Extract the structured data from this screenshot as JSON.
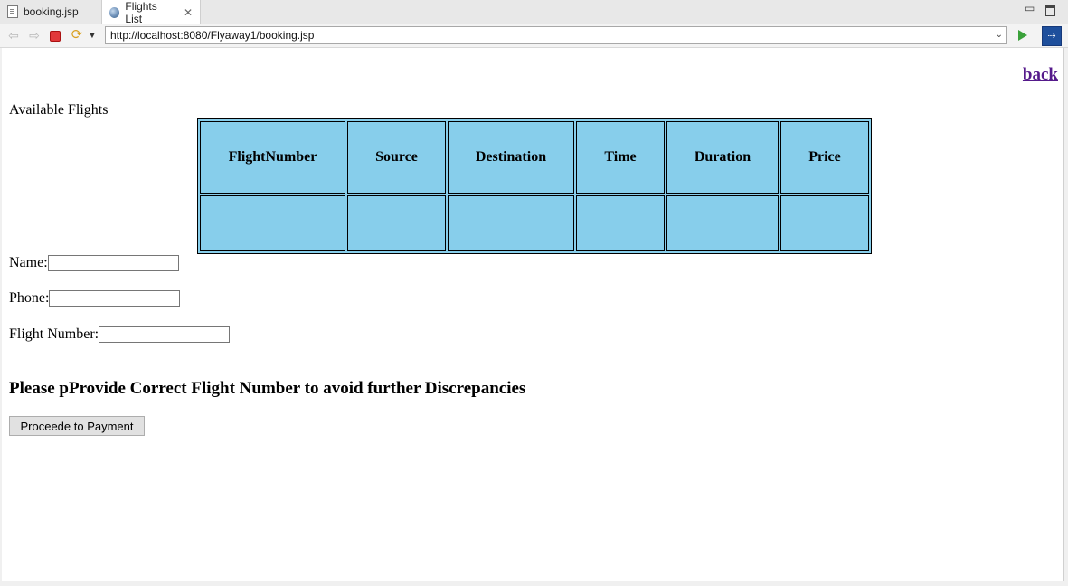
{
  "tabs": [
    {
      "label": "booking.jsp",
      "active": false
    },
    {
      "label": "Flights List",
      "active": true
    }
  ],
  "toolbar": {
    "url": "http://localhost:8080/Flyaway1/booking.jsp"
  },
  "page": {
    "back_link": "back",
    "heading": "Available Flights",
    "table": {
      "headers": [
        "FlightNumber",
        "Source",
        "Destination",
        "Time",
        "Duration",
        "Price"
      ],
      "rows": [
        [
          "",
          "",
          "",
          "",
          "",
          ""
        ]
      ]
    },
    "form": {
      "name_label": "Name:",
      "name_value": "",
      "phone_label": "Phone:",
      "phone_value": "",
      "flight_label": "Flight Number:",
      "flight_value": ""
    },
    "notice": "Please pProvide Correct Flight Number to avoid further Discrepancies",
    "submit_label": "Proceede to Payment"
  },
  "colors": {
    "table_bg": "#87ceeb",
    "link_visited": "#551a8b"
  }
}
